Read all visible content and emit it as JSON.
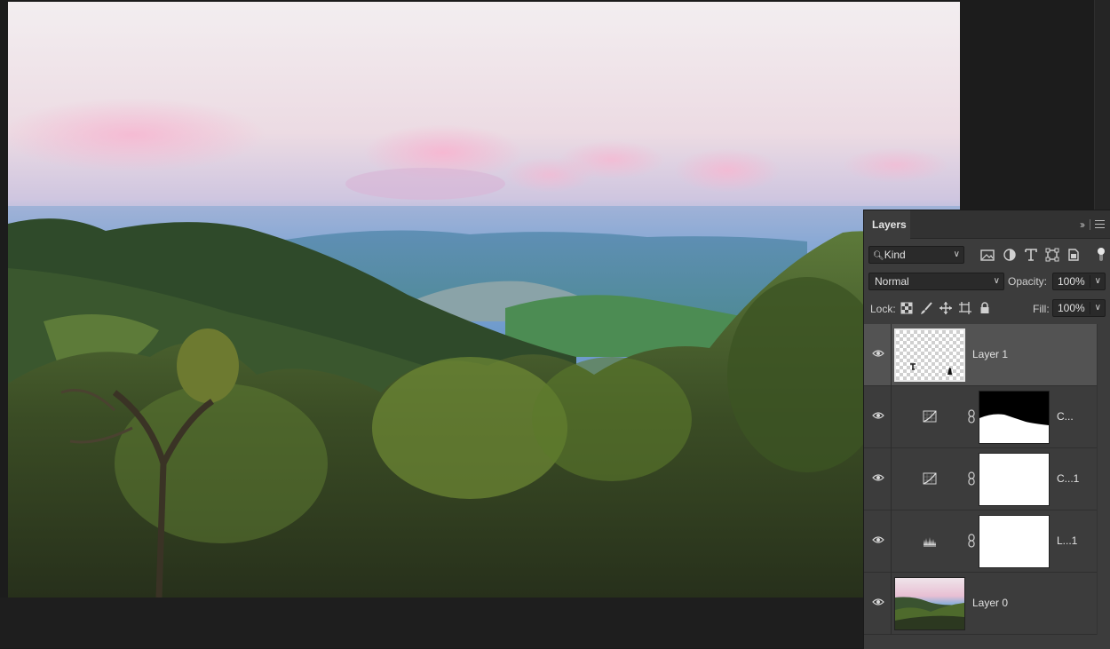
{
  "layers_panel": {
    "tab_label": "Layers",
    "collapse_label": "››",
    "filter": {
      "kind_label": "Kind",
      "icons": [
        "image-filter-icon",
        "adjustment-filter-icon",
        "type-filter-icon",
        "shape-filter-icon",
        "smart-object-filter-icon"
      ]
    },
    "blend_mode": "Normal",
    "opacity_label": "Opacity:",
    "opacity_value": "100%",
    "lock_label": "Lock:",
    "fill_label": "Fill:",
    "fill_value": "100%",
    "layers": [
      {
        "name": "Layer 1",
        "selected": true,
        "type": "pixel"
      },
      {
        "name": "C...",
        "selected": false,
        "type": "curves-adjustment"
      },
      {
        "name": "C...1",
        "selected": false,
        "type": "curves-adjustment"
      },
      {
        "name": "L...1",
        "selected": false,
        "type": "levels-adjustment"
      },
      {
        "name": "Layer 0",
        "selected": false,
        "type": "pixel"
      }
    ]
  },
  "colors": {
    "panel_bg": "#3c3c3c",
    "selected_row": "#535353",
    "workspace_bg": "#1c1c1c"
  }
}
